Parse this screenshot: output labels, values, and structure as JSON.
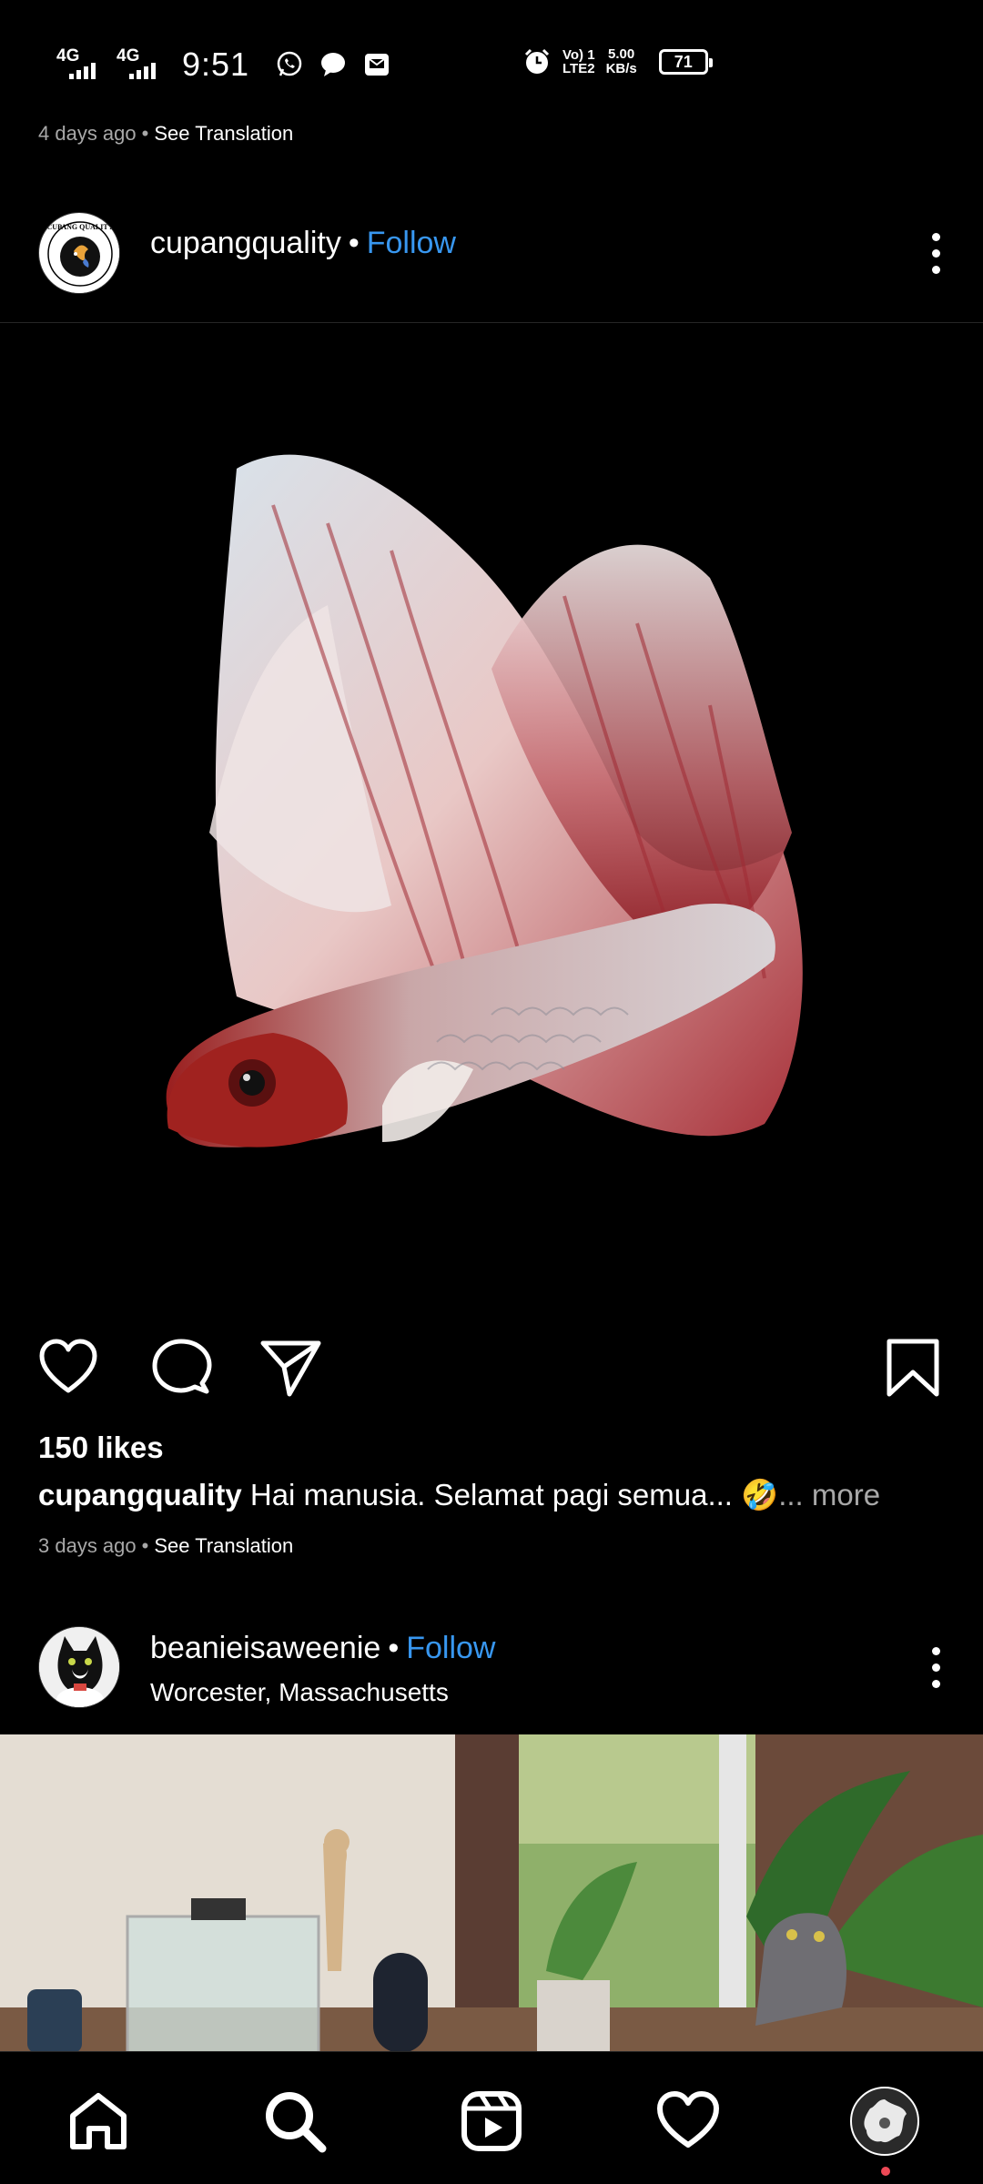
{
  "status_bar": {
    "network1": "4G",
    "network2": "4G",
    "time": "9:51",
    "volte_line1": "Vo) 1",
    "volte_line2": "LTE2",
    "speed_value": "5.00",
    "speed_unit": "KB/s",
    "battery": "71",
    "icons": [
      "whatsapp-icon",
      "message-icon",
      "mail-icon",
      "alarm-icon"
    ]
  },
  "previous_post": {
    "time_ago": "4 days ago",
    "separator": "•",
    "see_translation": "See Translation"
  },
  "post1": {
    "username": "cupangquality",
    "separator": "•",
    "follow": "Follow",
    "avatar_text": "CUPANG QUALITY",
    "image_alt": "betta fish",
    "likes": "150 likes",
    "caption_user": "cupangquality",
    "caption_text": "Hai manusia. Selamat pagi semua... 🤣",
    "caption_more": "... more",
    "time_ago": "3 days ago",
    "see_translation": "See Translation"
  },
  "post2": {
    "username": "beanieisaweenie",
    "separator": "•",
    "follow": "Follow",
    "location": "Worcester, Massachusetts"
  },
  "bottom_nav": {
    "items": [
      "home-icon",
      "search-icon",
      "reels-icon",
      "activity-heart-icon",
      "profile-avatar"
    ]
  },
  "colors": {
    "background": "#000000",
    "follow_blue": "#3897f0",
    "secondary_text": "#a8a8a8",
    "notification_dot": "#ed4956"
  }
}
